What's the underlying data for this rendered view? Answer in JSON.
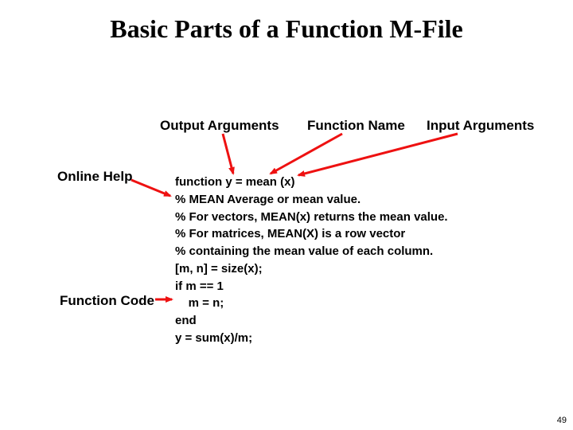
{
  "title": "Basic Parts of a Function M-File",
  "labels": {
    "output_args": "Output Arguments",
    "function_name": "Function Name",
    "input_args": "Input Arguments",
    "online_help": "Online Help",
    "function_code": "Function Code"
  },
  "code": {
    "l1": "function y = mean (x)",
    "l2": "% MEAN Average or mean value.",
    "l3": "% For vectors, MEAN(x) returns the mean value.",
    "l4": "% For matrices, MEAN(X) is a row vector",
    "l5": "% containing the mean value of each column.",
    "l6": "[m, n] = size(x);",
    "l7": "if m == 1",
    "l8": "    m = n;",
    "l9": "end",
    "l10": "y = sum(x)/m;"
  },
  "slide_number": "49"
}
